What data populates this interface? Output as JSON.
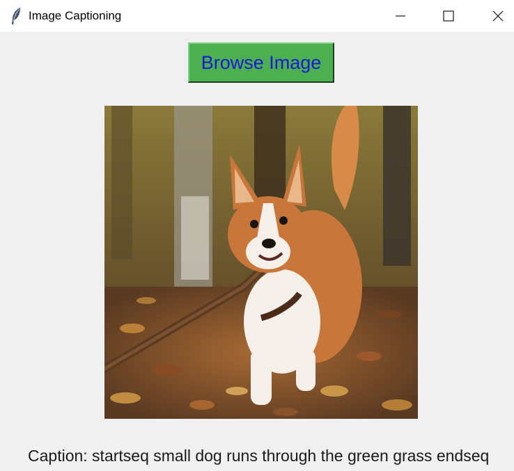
{
  "window": {
    "title": "Image Captioning",
    "icon": "feather-icon",
    "controls": {
      "minimize_icon": "minimize-icon",
      "maximize_icon": "maximize-icon",
      "close_icon": "close-icon"
    }
  },
  "main": {
    "browse_button_label": "Browse Image",
    "image": {
      "subject": "corgi carrying a stick through autumn leaves"
    },
    "caption_text": "Caption: startseq small dog runs through the green grass endseq"
  },
  "colors": {
    "button_bg": "#4caf50",
    "button_text": "#1a1ad6",
    "window_bg": "#f0f0f0",
    "titlebar_bg": "#ffffff"
  }
}
